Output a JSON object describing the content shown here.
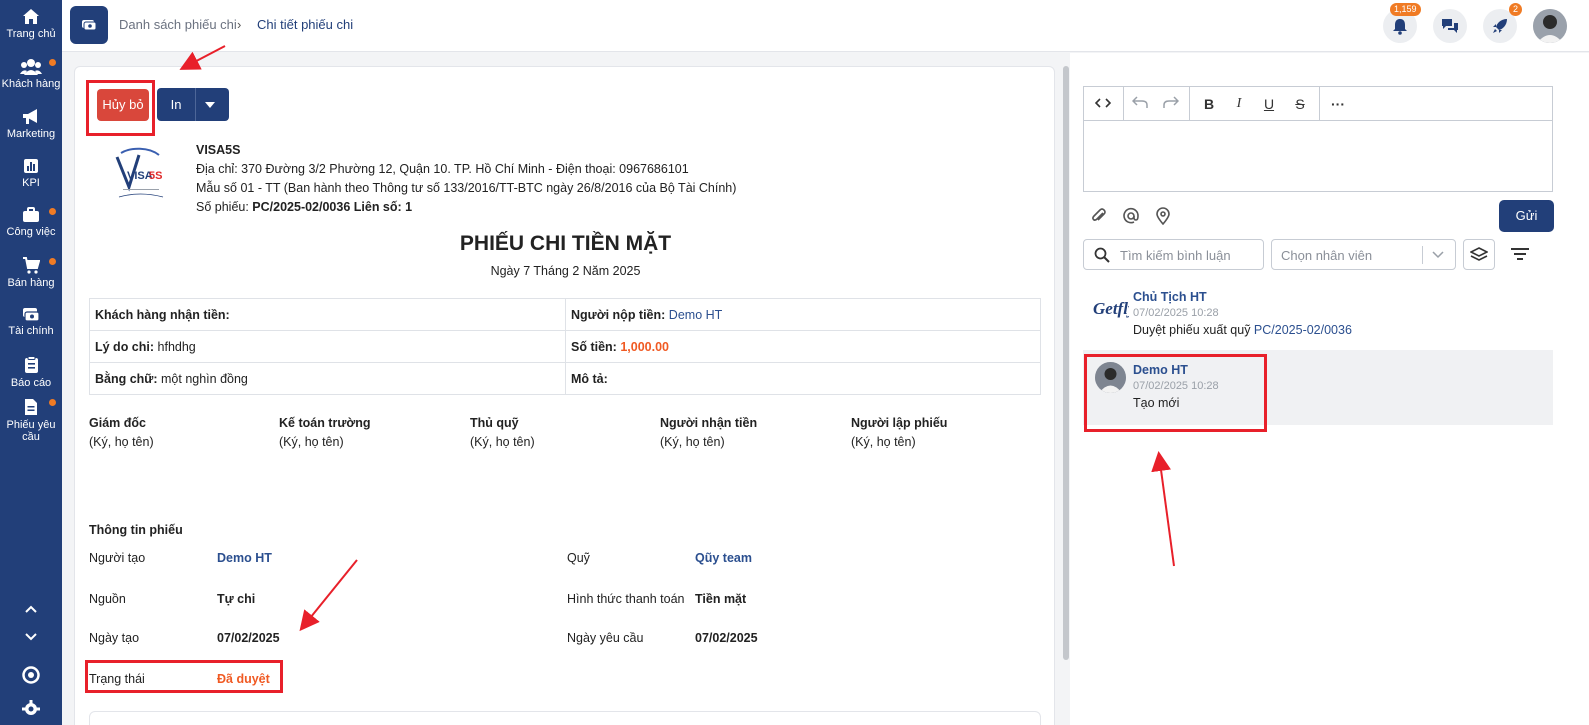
{
  "sidebar": {
    "items": [
      {
        "label": "Trang chủ",
        "icon": "home-icon"
      },
      {
        "label": "Khách hàng",
        "icon": "users-icon"
      },
      {
        "label": "Marketing",
        "icon": "megaphone-icon"
      },
      {
        "label": "KPI",
        "icon": "chart-icon"
      },
      {
        "label": "Công việc",
        "icon": "briefcase-icon"
      },
      {
        "label": "Bán hàng",
        "icon": "cart-icon"
      },
      {
        "label": "Tài chính",
        "icon": "wallet-icon"
      },
      {
        "label": "Báo cáo",
        "icon": "clipboard-icon"
      },
      {
        "label": "Phiếu yêu cầu",
        "icon": "document-icon"
      }
    ]
  },
  "topbar": {
    "breadcrumb_parent": "Danh sách phiếu chi",
    "breadcrumb_sep": "›",
    "breadcrumb_current": "Chi tiết phiếu chi",
    "notifications_badge": "1,159",
    "rocket_badge": "2"
  },
  "actions": {
    "cancel_label": "Hủy bỏ",
    "print_label": "In"
  },
  "company": {
    "name": "VISA5S",
    "address": "Địa chỉ: 370 Đường 3/2 Phường 12, Quận 10. TP. Hồ Chí Minh - Điện thoại: 0967686101",
    "form_note": "Mẫu số 01 - TT (Ban hành theo Thông tư số 133/2016/TT-BTC ngày 26/8/2016 của Bộ Tài Chính)",
    "voucher_prefix": "Số phiếu: ",
    "voucher_number": "PC/2025-02/0036 Liên số: 1",
    "logo_text": "VISA5S"
  },
  "voucher": {
    "title": "PHIẾU CHI TIỀN MẶT",
    "date": "Ngày 7 Tháng 2 Năm 2025",
    "recipient_label": "Khách hàng nhận tiền:",
    "payer_label": "Người nộp tiền:",
    "payer_value": "Demo HT",
    "reason_label": "Lý do chi:",
    "reason_value": "hfhdhg",
    "amount_label": "Số tiền:",
    "amount_value": "1,000.00",
    "words_label": "Bằng chữ:",
    "words_value": "một nghìn đồng",
    "desc_label": "Mô tả:"
  },
  "signatures": [
    {
      "role": "Giám đốc",
      "note": "(Ký, họ tên)"
    },
    {
      "role": "Kế toán trường",
      "note": "(Ký, họ tên)"
    },
    {
      "role": "Thủ quỹ",
      "note": "(Ký, họ tên)"
    },
    {
      "role": "Người nhận tiền",
      "note": "(Ký, họ tên)"
    },
    {
      "role": "Người lập phiếu",
      "note": "(Ký, họ tên)"
    }
  ],
  "voucher_info": {
    "heading": "Thông tin phiếu",
    "creator_label": "Người tạo",
    "creator_value": "Demo HT",
    "fund_label": "Quỹ",
    "fund_value": "Qũy team",
    "source_label": "Nguồn",
    "source_value": "Tự chi",
    "payment_label": "Hình thức thanh toán",
    "payment_value": "Tiền mặt",
    "created_label": "Ngày tạo",
    "created_value": "07/02/2025",
    "request_label": "Ngày yêu cầu",
    "request_value": "07/02/2025",
    "status_label": "Trạng thái",
    "status_value": "Đã duyệt"
  },
  "comments_panel": {
    "send_label": "Gửi",
    "search_placeholder": "Tìm kiếm bình luận",
    "employee_placeholder": "Chọn nhân viên",
    "comments": [
      {
        "author": "Chủ Tịch HT",
        "time": "07/02/2025 10:28",
        "text": "Duyệt phiếu xuất quỹ ",
        "link": "PC/2025-02/0036",
        "avatar_text": "Getfly"
      },
      {
        "author": "Demo HT",
        "time": "07/02/2025 10:28",
        "text": "Tạo mới"
      }
    ]
  },
  "colors": {
    "primary": "#223f79",
    "danger": "#d9473b",
    "accent": "#f05a23",
    "highlight": "#e8202a"
  }
}
